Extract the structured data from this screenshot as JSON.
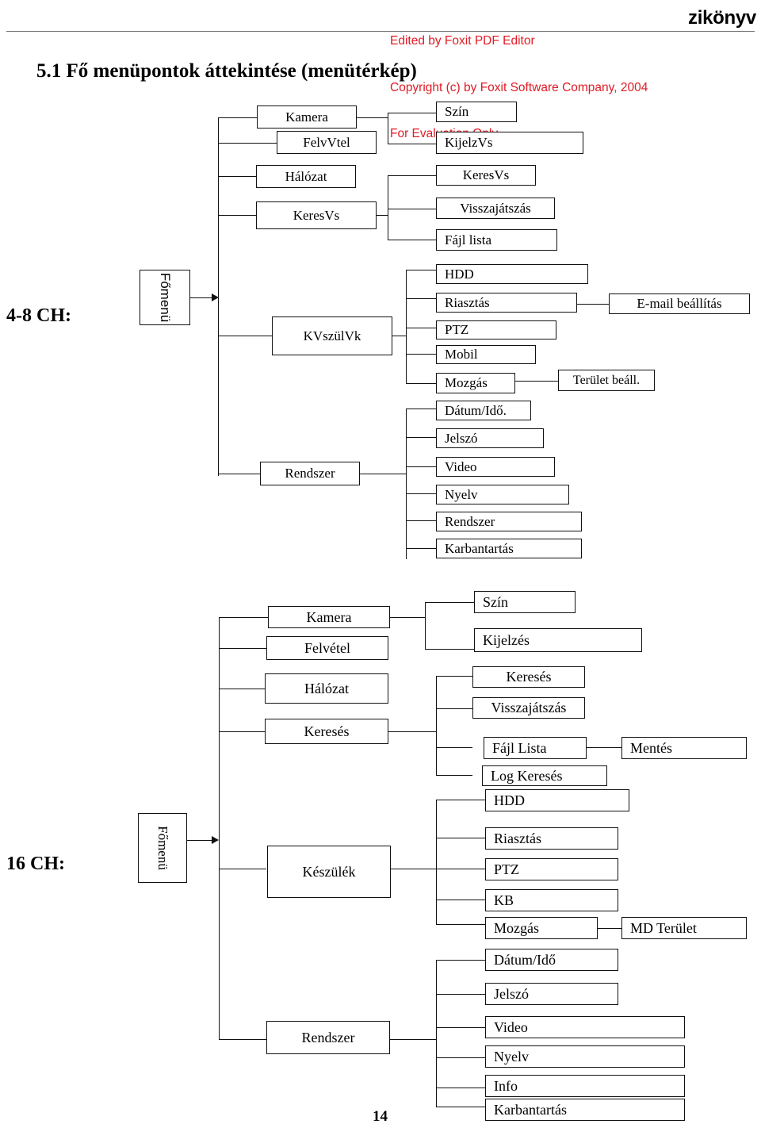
{
  "header": {
    "foxit_lines": [
      "Edited by Foxit PDF Editor",
      "Copyright (c) by Foxit Software Company, 2004",
      "For Evaluation Only."
    ],
    "book_word": "zikönyv",
    "accent_color": "#e01b24"
  },
  "section_title": "5.1 Fő menüpontok áttekintése (menütérkép)",
  "page_number": "14",
  "diagrams": [
    {
      "label": "4-8 CH:",
      "root": "Főmenü",
      "level1": [
        "Kamera",
        "FelvVtel",
        "Hálózat",
        "KeresVs",
        "KVszülVk",
        "Rendszer"
      ],
      "level2": {
        "Kamera": [
          "Szín",
          "KijelzVs"
        ],
        "KeresVs": [
          "KeresVs",
          "Visszajátszás",
          "Fájl lista"
        ],
        "KVszülVk": [
          "HDD",
          "Riasztás",
          "PTZ",
          "Mobil",
          "Mozgás"
        ],
        "Rendszer": [
          "Dátum/Idő.",
          "Jelszó",
          "Video",
          "Nyelv",
          "Rendszer",
          "Karbantartás"
        ]
      },
      "level3": {
        "Riasztás": "E-mail beállítás",
        "Mozgás": "Terület beáll."
      }
    },
    {
      "label": "16 CH:",
      "root": "Főmenü",
      "level1": [
        "Kamera",
        "Felvétel",
        "Hálózat",
        "Keresés",
        "Készülék",
        "Rendszer"
      ],
      "level2": {
        "Kamera": [
          "Szín",
          "Kijelzés"
        ],
        "Keresés": [
          "Keresés",
          "Visszajátszás",
          "Fájl Lista",
          "Log Keresés"
        ],
        "Készülék": [
          "HDD",
          "Riasztás",
          "PTZ",
          "KB",
          "Mozgás"
        ],
        "Rendszer": [
          "Dátum/Idő",
          "Jelszó",
          "Video",
          "Nyelv",
          "Info",
          "Karbantartás"
        ]
      },
      "level3": {
        "Fájl Lista": "Mentés",
        "Mozgás": "MD Terület"
      }
    }
  ]
}
